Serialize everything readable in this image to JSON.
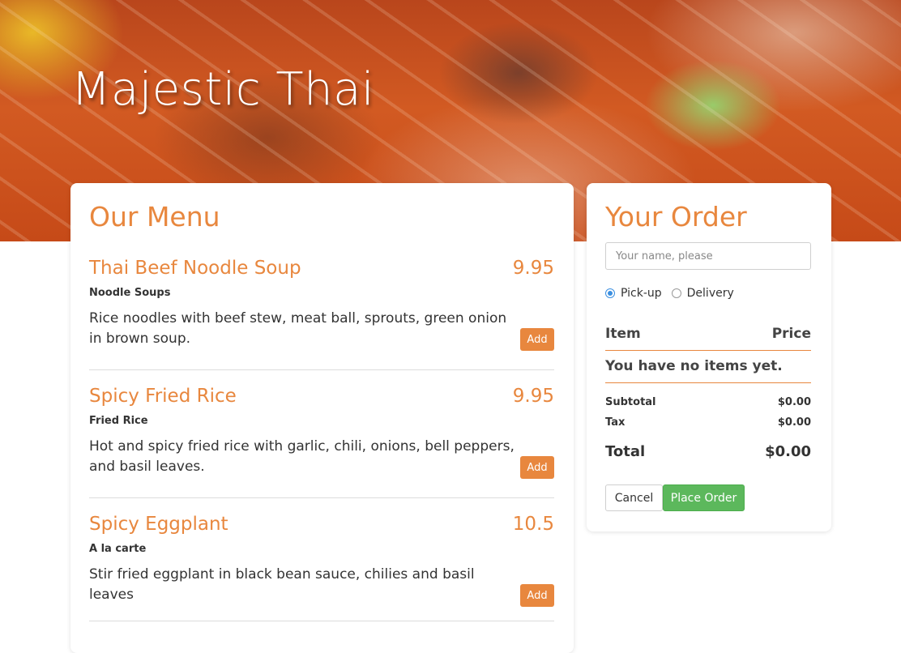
{
  "header": {
    "title": "Majestic Thai"
  },
  "menu": {
    "title": "Our Menu",
    "add_label": "Add",
    "items": [
      {
        "name": "Thai Beef Noodle Soup",
        "price": "9.95",
        "category": "Noodle Soups",
        "description": "Rice noodles with beef stew, meat ball, sprouts, green onion in brown soup."
      },
      {
        "name": "Spicy Fried Rice",
        "price": "9.95",
        "category": "Fried Rice",
        "description": "Hot and spicy fried rice with garlic, chili, onions, bell peppers, and basil leaves."
      },
      {
        "name": "Spicy Eggplant",
        "price": "10.5",
        "category": "A la carte",
        "description": "Stir fried eggplant in black bean sauce, chilies and basil leaves"
      }
    ]
  },
  "order": {
    "title": "Your Order",
    "name_placeholder": "Your name, please",
    "name_value": "",
    "options": [
      {
        "label": "Pick-up",
        "checked": true
      },
      {
        "label": "Delivery",
        "checked": false
      }
    ],
    "col_item": "Item",
    "col_price": "Price",
    "empty_message": "You have no items yet.",
    "subtotal_label": "Subtotal",
    "subtotal_value": "$0.00",
    "tax_label": "Tax",
    "tax_value": "$0.00",
    "total_label": "Total",
    "total_value": "$0.00",
    "cancel_label": "Cancel",
    "place_label": "Place Order"
  },
  "colors": {
    "accent": "#e8873e",
    "success": "#5cb85c",
    "radio": "#3b8fe0"
  }
}
